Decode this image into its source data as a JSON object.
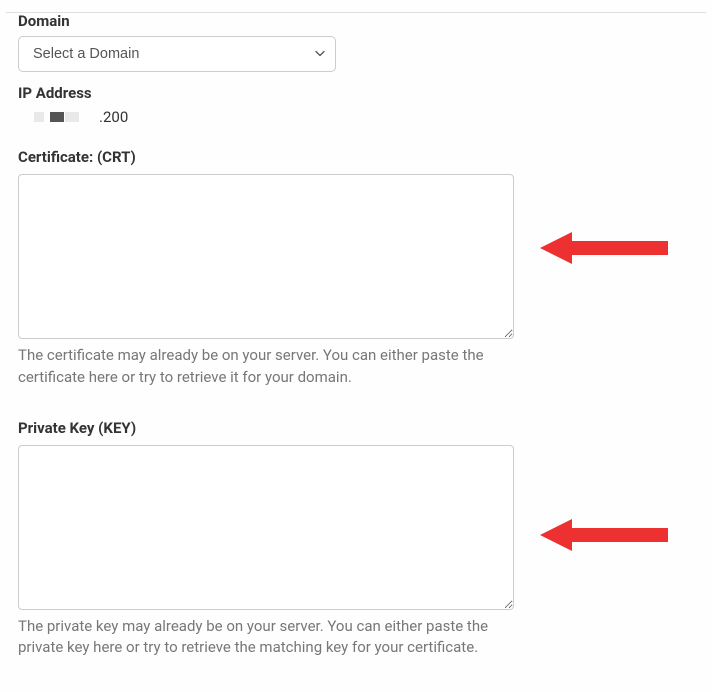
{
  "domain_field": {
    "label": "Domain",
    "placeholder": "Select a Domain"
  },
  "ip_field": {
    "label": "IP Address",
    "visible_suffix": ".200"
  },
  "certificate_field": {
    "label": "Certificate: (CRT)",
    "value": "",
    "helper": "The certificate may already be on your server. You can either paste the certificate here or try to retrieve it for your domain."
  },
  "private_key_field": {
    "label": "Private Key (KEY)",
    "value": "",
    "helper": "The private key may already be on your server. You can either paste the private key here or try to retrieve the matching key for your certificate."
  }
}
